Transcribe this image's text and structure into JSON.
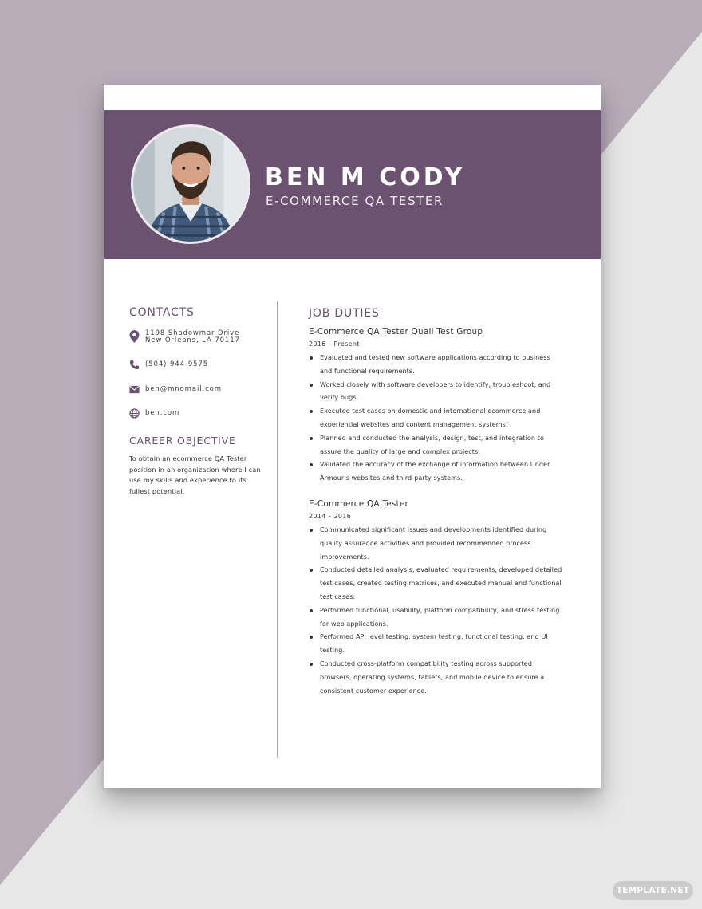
{
  "colors": {
    "accent": "#6b5270",
    "background_mauve": "#b9acb9",
    "background_light": "#e7e7e7"
  },
  "header": {
    "name": "BEN M CODY",
    "title": "E-COMMERCE QA TESTER"
  },
  "contacts": {
    "heading": "CONTACTS",
    "address_line1": "1198 Shadowmar Drive",
    "address_line2": "New Orleans, LA 70117",
    "phone": "(504) 944-9575",
    "email": "ben@mnomail.com",
    "website": "ben.com",
    "icons": [
      "location-pin-icon",
      "phone-icon",
      "envelope-icon",
      "globe-icon"
    ]
  },
  "objective": {
    "heading": "CAREER OBJECTIVE",
    "text": "To obtain an ecommerce QA Tester position in an organization where I can use my skills and experience to its fullest potential."
  },
  "duties": {
    "heading": "JOB DUTIES",
    "jobs": [
      {
        "title": "E-Commerce QA Tester Quali Test Group",
        "dates": "2016 – Present",
        "bullets": [
          "Evaluated and tested new software applications according to business and functional requirements.",
          "Worked closely with software developers to identify, troubleshoot, and verify bugs.",
          "Executed test cases on domestic and international ecommerce and experiential websites and content management systems.",
          "Planned and conducted the analysis, design, test, and integration to assure the quality of large and complex projects.",
          "Validated the accuracy of the exchange of information between Under Armour's websites and third-party systems."
        ]
      },
      {
        "title": "E-Commerce QA Tester",
        "dates": "2014 – 2016",
        "bullets": [
          "Communicated significant issues and developments identified during quality assurance activities and provided recommended process improvements.",
          "Conducted detailed analysis, evaluated requirements, developed detailed test cases, created testing matrices, and executed manual and functional test cases.",
          "Performed functional, usability, platform compatibility, and stress testing for web applications.",
          "Performed API level testing, system testing, functional testing, and UI testing.",
          "Conducted cross-platform compatibility testing across supported browsers, operating systems, tablets, and mobile device to ensure a consistent customer experience."
        ]
      }
    ]
  },
  "watermark": "TEMPLATE.NET"
}
